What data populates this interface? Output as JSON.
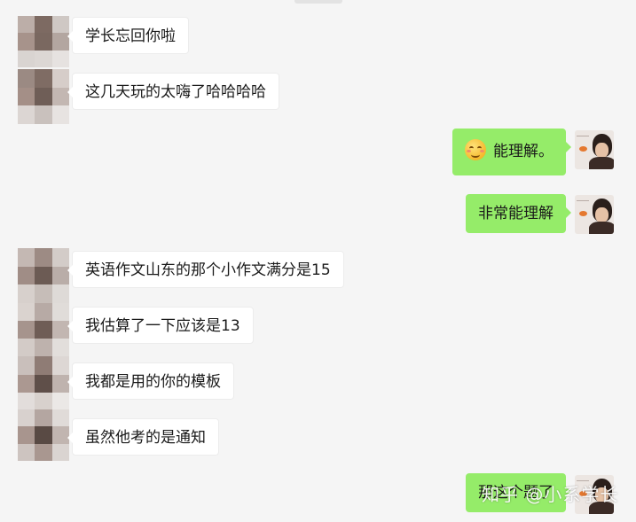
{
  "messages": {
    "m1": "学长忘回你啦",
    "m2": "这几天玩的太嗨了哈哈哈哈",
    "m3": "能理解。",
    "m4": "非常能理解",
    "m5": "英语作文山东的那个小作文满分是15",
    "m6": "我估算了一下应该是13",
    "m7": "我都是用的你的模板",
    "m8": "虽然他考的是通知",
    "m9": "那这个题了"
  },
  "watermark": "知乎 @小系学长",
  "colors": {
    "background": "#f5f5f5",
    "sent_bubble": "#95ec69",
    "received_bubble": "#ffffff"
  }
}
